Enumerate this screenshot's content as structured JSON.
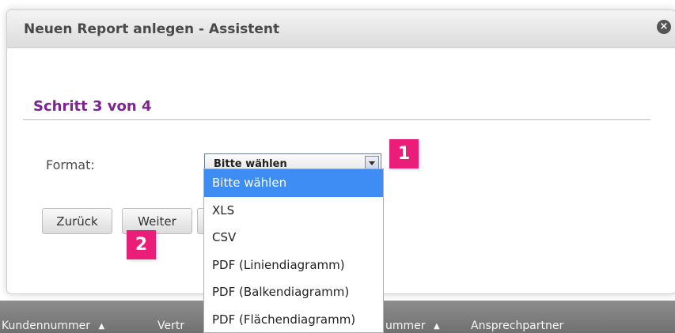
{
  "dialog": {
    "title": "Neuen Report anlegen - Assistent",
    "close_icon": "close-icon",
    "step_title": "Schritt 3 von 4",
    "format_label": "Format:",
    "select": {
      "current_value": "Bitte wählen",
      "arrow_icon": "chevron-down-icon",
      "options": [
        "Bitte wählen",
        "XLS",
        "CSV",
        "PDF (Liniendiagramm)",
        "PDF (Balkendiagramm)",
        "PDF (Flächendiagramm)"
      ]
    },
    "buttons": {
      "back": "Zurück",
      "next": "Weiter"
    }
  },
  "annotations": {
    "marker_1": "1",
    "marker_2": "2",
    "color": "#ea1e79"
  },
  "background_table": {
    "columns": [
      "Kundennummer",
      "Vertr",
      "ummer",
      "Ansprechpartner"
    ],
    "sort_icon": "sort-up-icon"
  },
  "colors": {
    "step_title": "#7a2590",
    "selected_option_bg": "#3d8df4",
    "header_bg": "#707070"
  }
}
